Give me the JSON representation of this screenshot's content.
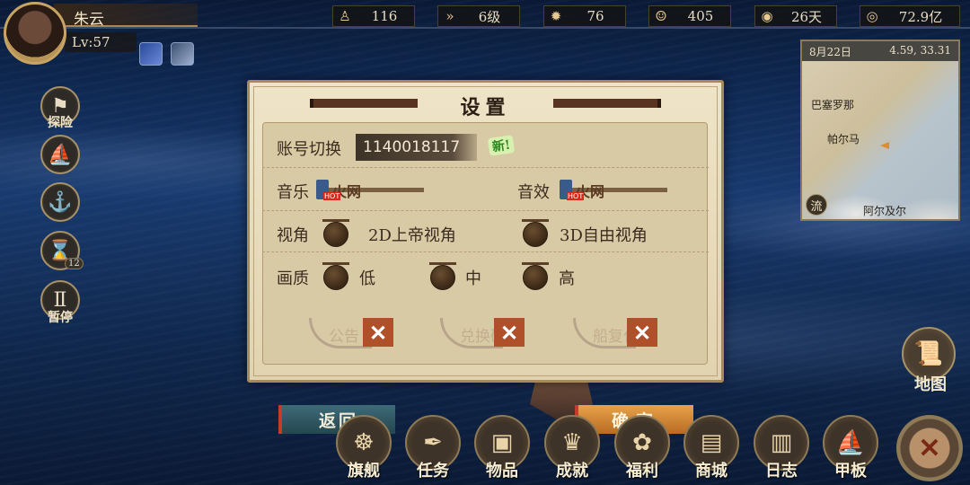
{
  "player": {
    "name": "朱云",
    "level": "Lv:57"
  },
  "resources": [
    {
      "icon": "sailor-icon",
      "glyph": "♙",
      "value": "116"
    },
    {
      "icon": "speed-icon",
      "glyph": "»",
      "value": "6级"
    },
    {
      "icon": "cannon-icon",
      "glyph": "✹",
      "value": "76"
    },
    {
      "icon": "crew-icon",
      "glyph": "☺",
      "value": "405"
    },
    {
      "icon": "bread-icon",
      "glyph": "◉",
      "value": "26天"
    },
    {
      "icon": "coin-icon",
      "glyph": "◎",
      "value": "72.9亿"
    }
  ],
  "left_menu": {
    "explore": "探险",
    "pause": "暂停",
    "timer_badge": "12"
  },
  "minimap": {
    "date": "8月22日",
    "coords": "4.59, 33.31",
    "labels": {
      "barcelona": "巴塞罗那",
      "palma": "帕尔马",
      "algiers": "阿尔及尔"
    },
    "flow": "流"
  },
  "map_button": "地图",
  "dialog": {
    "title": "设置",
    "account_label": "账号切换",
    "account_value": "1140018117",
    "new_tag": "新!",
    "music_label": "音乐",
    "sound_label": "音效",
    "slider_text": "火网",
    "hot_tag": "HOT",
    "view_label": "视角",
    "view_2d": "2D上帝视角",
    "view_3d": "3D自由视角",
    "quality_label": "画质",
    "quality_low": "低",
    "quality_mid": "中",
    "quality_high": "高",
    "btn_notice": "公告",
    "btn_redeem": "兑换码",
    "btn_reset": "船复位"
  },
  "buttons": {
    "return": "返回",
    "confirm": "确定"
  },
  "bottom_menu": [
    {
      "label": "旗舰",
      "icon": "wheel-icon",
      "glyph": "☸"
    },
    {
      "label": "任务",
      "icon": "quill-icon",
      "glyph": "✒"
    },
    {
      "label": "物品",
      "icon": "bag-icon",
      "glyph": "▣"
    },
    {
      "label": "成就",
      "icon": "trophy-icon",
      "glyph": "♛"
    },
    {
      "label": "福利",
      "icon": "gift-icon",
      "glyph": "✿"
    },
    {
      "label": "商城",
      "icon": "chest-icon",
      "glyph": "▤"
    },
    {
      "label": "日志",
      "icon": "book-icon",
      "glyph": "▥"
    },
    {
      "label": "甲板",
      "icon": "ship-icon",
      "glyph": "⛵"
    }
  ]
}
